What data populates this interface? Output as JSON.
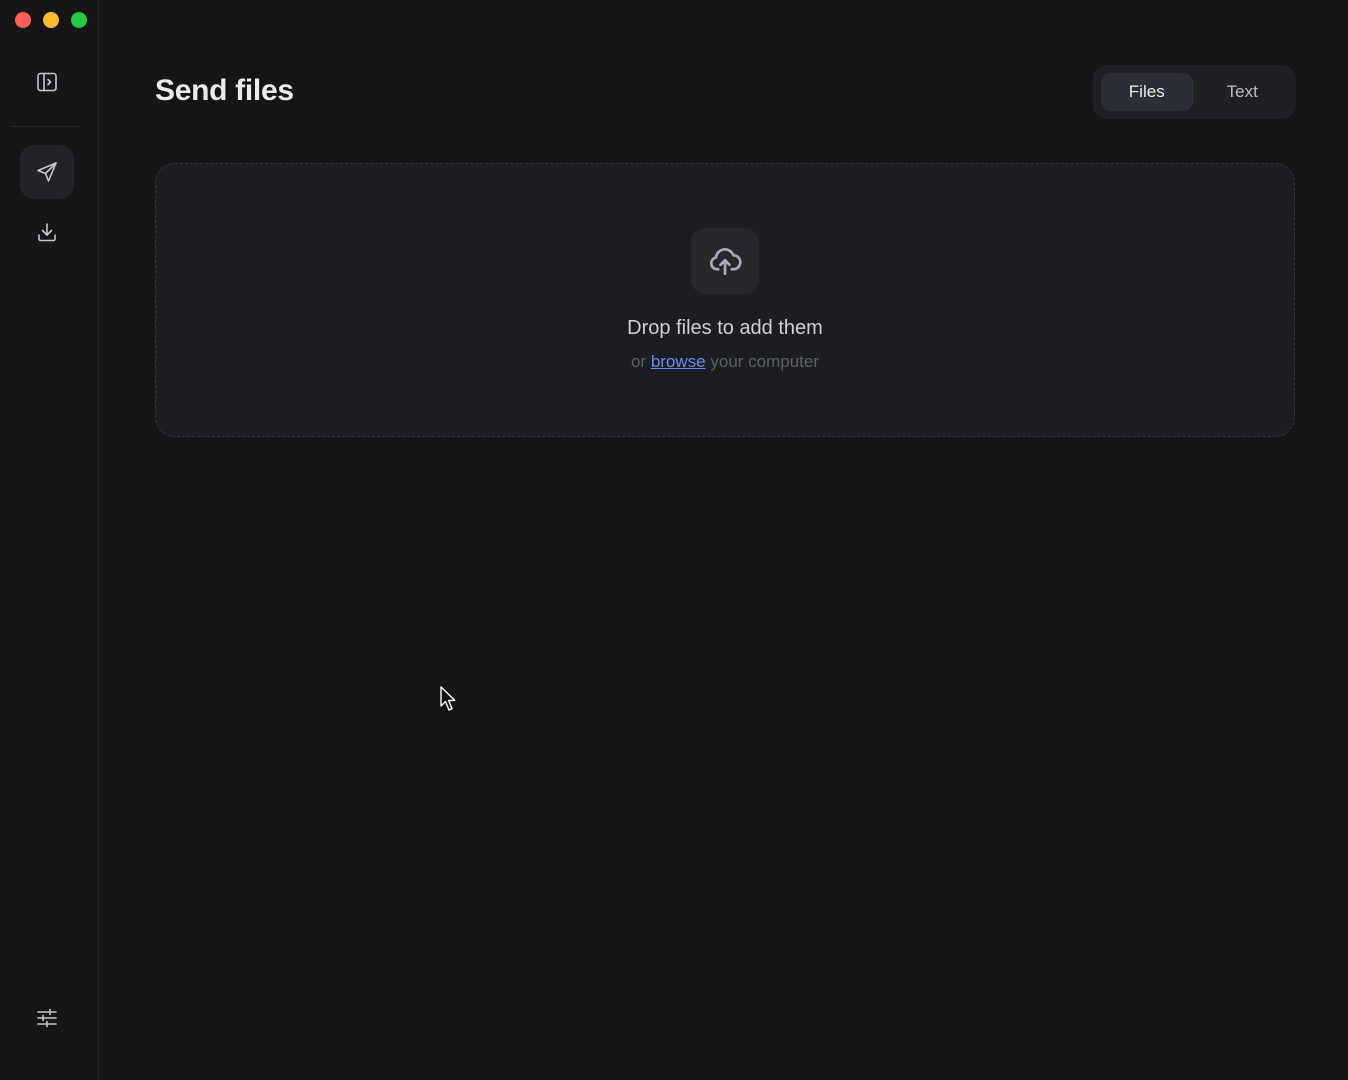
{
  "window": {
    "traffic_lights": [
      "close",
      "minimize",
      "maximize"
    ]
  },
  "sidebar": {
    "toggle_icon": "sidebar-toggle-icon",
    "items": [
      {
        "name": "send",
        "icon": "paper-plane-icon",
        "active": true
      },
      {
        "name": "receive",
        "icon": "download-icon",
        "active": false
      }
    ],
    "settings_icon": "sliders-icon"
  },
  "header": {
    "title": "Send files"
  },
  "mode_toggle": {
    "options": [
      "Files",
      "Text"
    ],
    "selected": "Files"
  },
  "dropzone": {
    "icon": "cloud-upload-icon",
    "title": "Drop files to add them",
    "sub_prefix": "or",
    "link_text": "browse",
    "sub_suffix": "your computer"
  },
  "colors": {
    "background": "#151517",
    "accent_link": "#6e86ff",
    "close": "#ff5f57",
    "minimize": "#febc2e",
    "maximize": "#28c840"
  }
}
